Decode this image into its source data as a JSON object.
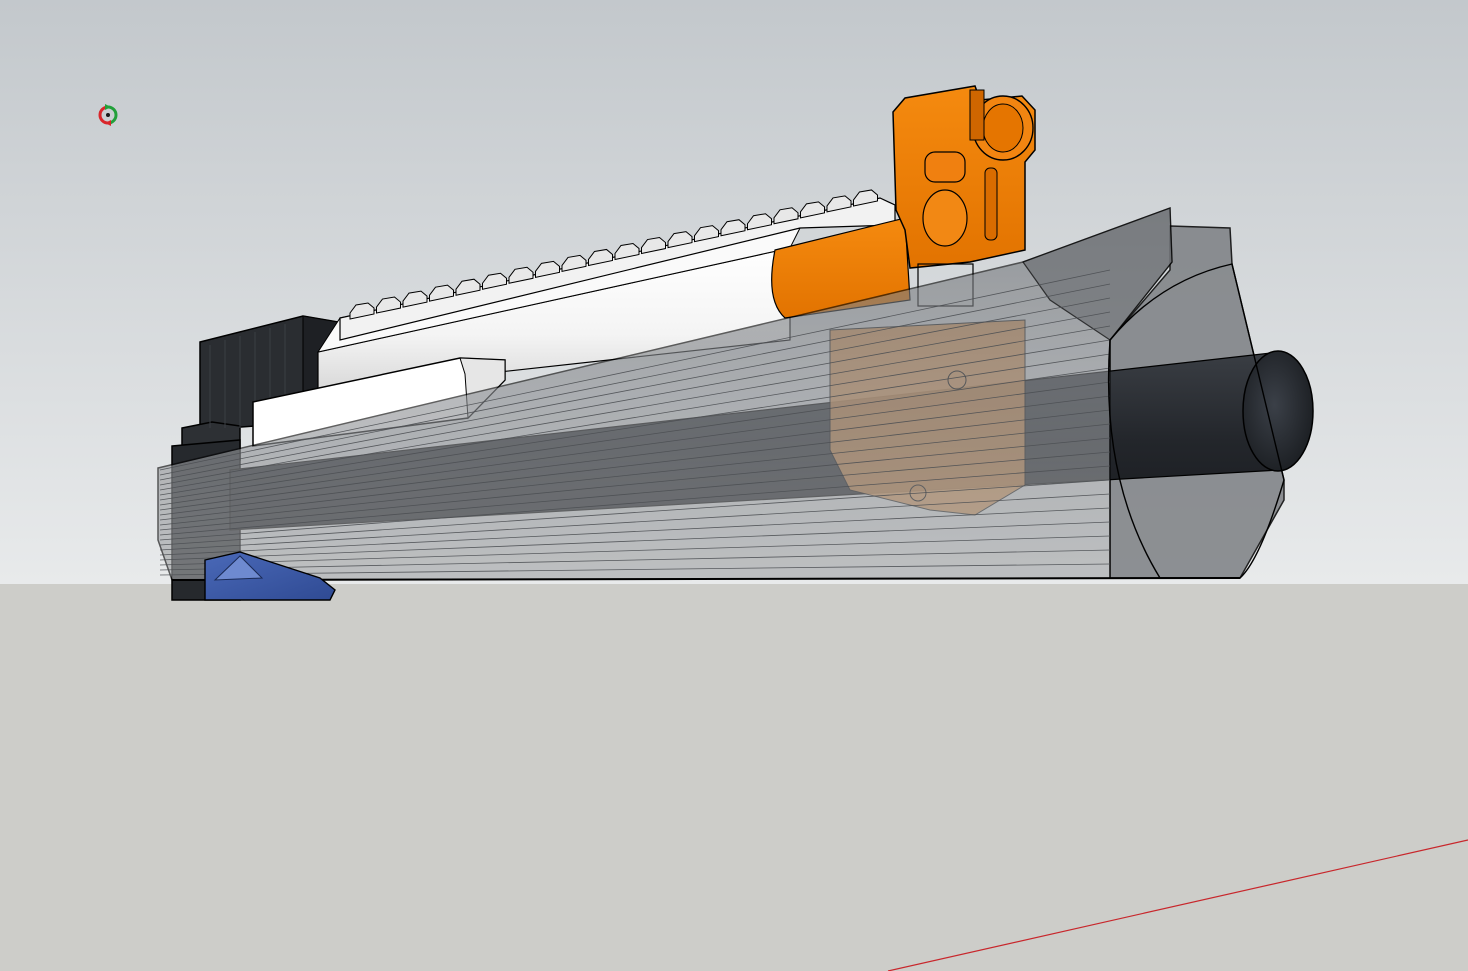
{
  "viewport": {
    "sky_top_color": "#c3c8cc",
    "sky_bottom_color": "#e8eaeb",
    "ground_color": "#cdcdc9",
    "edge_color": "#000000",
    "red_axis_color": "#c8262b"
  },
  "cursor": {
    "tool": "orbit-icon",
    "colors": [
      "#d9262b",
      "#22a03a"
    ]
  },
  "model": {
    "components": [
      {
        "name": "handguard-shell",
        "material": "translucent-gray",
        "color": "#8a8d90"
      },
      {
        "name": "barrel",
        "material": "dark",
        "color": "#1f2226"
      },
      {
        "name": "gas-block",
        "material": "orange",
        "color": "#f07d00"
      },
      {
        "name": "gas-tube",
        "material": "white",
        "color": "#ffffff"
      },
      {
        "name": "picatinny-rail",
        "material": "white",
        "color": "#f2f2f2"
      },
      {
        "name": "receiver-block",
        "material": "dark",
        "color": "#2a2d31"
      },
      {
        "name": "lock-wedge",
        "material": "blue",
        "color": "#3b5aa8"
      }
    ]
  }
}
